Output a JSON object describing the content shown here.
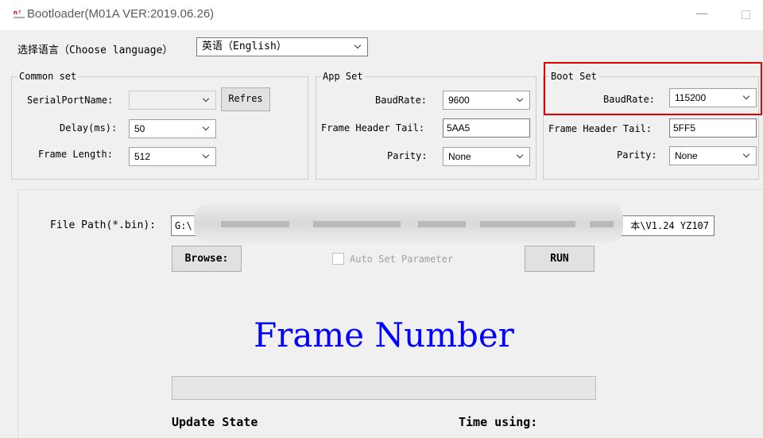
{
  "window": {
    "title": "Bootloader(M01A VER:2019.06.26)",
    "minimize_glyph": "—",
    "app_icon": "app-logo-icon"
  },
  "language": {
    "label": "选择语言（Choose language）",
    "selected": "英语（English）"
  },
  "common_set": {
    "title": "Common set",
    "serial_port_label": "SerialPortName:",
    "serial_port_value": "",
    "refresh_button": "Refres",
    "delay_label": "Delay(ms):",
    "delay_value": "50",
    "frame_length_label": "Frame Length:",
    "frame_length_value": "512"
  },
  "app_set": {
    "title": "App Set",
    "baudrate_label": "BaudRate:",
    "baudrate_value": "9600",
    "frame_header_tail_label": "Frame Header Tail:",
    "frame_header_tail_value": "5AA5",
    "parity_label": "Parity:",
    "parity_value": "None"
  },
  "boot_set": {
    "title": "Boot Set",
    "baudrate_label": "BaudRate:",
    "baudrate_value": "115200",
    "frame_header_tail_label": "Frame Header Tail:",
    "frame_header_tail_value": "5FF5",
    "parity_label": "Parity:",
    "parity_value": "None",
    "highlight_color": "#e00000"
  },
  "file": {
    "path_label": "File Path(*.bin):",
    "path_prefix": "G:\\(",
    "path_suffix": "本\\V1.24 YZ107",
    "browse_button": "Browse:",
    "auto_set_label": "Auto Set  Parameter",
    "auto_set_checked": false,
    "run_button": "RUN"
  },
  "frame_number": {
    "label": "Frame Number",
    "color": "#0000ff"
  },
  "progress": {
    "value": 0
  },
  "status": {
    "update_state_label": "Update State",
    "time_using_label": "Time using:"
  }
}
